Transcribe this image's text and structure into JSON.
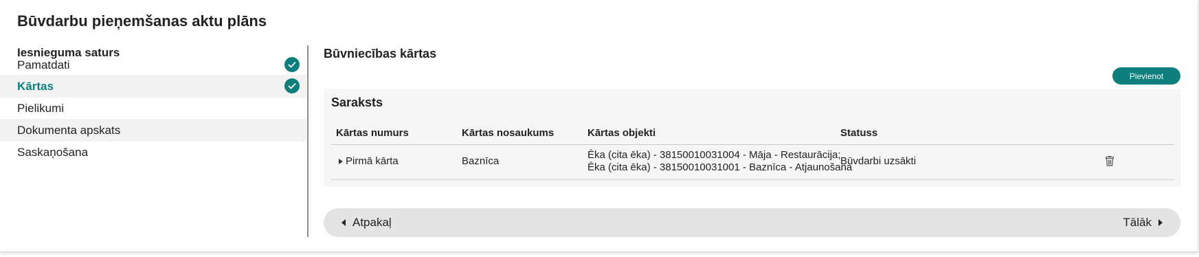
{
  "page": {
    "title": "Būvdarbu pieņemšanas aktu plāns"
  },
  "colors": {
    "accent": "#0e7f7c"
  },
  "sidebar": {
    "heading": "Iesnieguma saturs",
    "items": [
      {
        "label": "Pamatdati",
        "completed": true,
        "active": false
      },
      {
        "label": "Kārtas",
        "completed": true,
        "active": true
      },
      {
        "label": "Pielikumi",
        "completed": false,
        "active": false
      },
      {
        "label": "Dokumenta apskats",
        "completed": false,
        "active": false
      },
      {
        "label": "Saskaņošana",
        "completed": false,
        "active": false
      }
    ],
    "check_icon": "check-circle-icon"
  },
  "main": {
    "section_title": "Būvniecības kārtas",
    "add_button": "Pievienot",
    "list": {
      "title": "Saraksts",
      "columns": [
        "Kārtas numurs",
        "Kārtas nosaukums",
        "Kārtas objekti",
        "Statuss"
      ],
      "rows": [
        {
          "number": "Pirmā kārta",
          "name": "Baznīca",
          "objects": [
            "Ēka (cita ēka) - 38150010031004 - Māja - Restaurācija;",
            "Ēka (cita ēka) - 38150010031001 - Baznīca - Atjaunošana"
          ],
          "status": "Būvdarbi uzsākti",
          "expand_icon": "caret-right-icon",
          "delete_icon": "trash-icon"
        }
      ]
    }
  },
  "nav": {
    "back": "Atpakaļ",
    "next": "Tālāk"
  }
}
